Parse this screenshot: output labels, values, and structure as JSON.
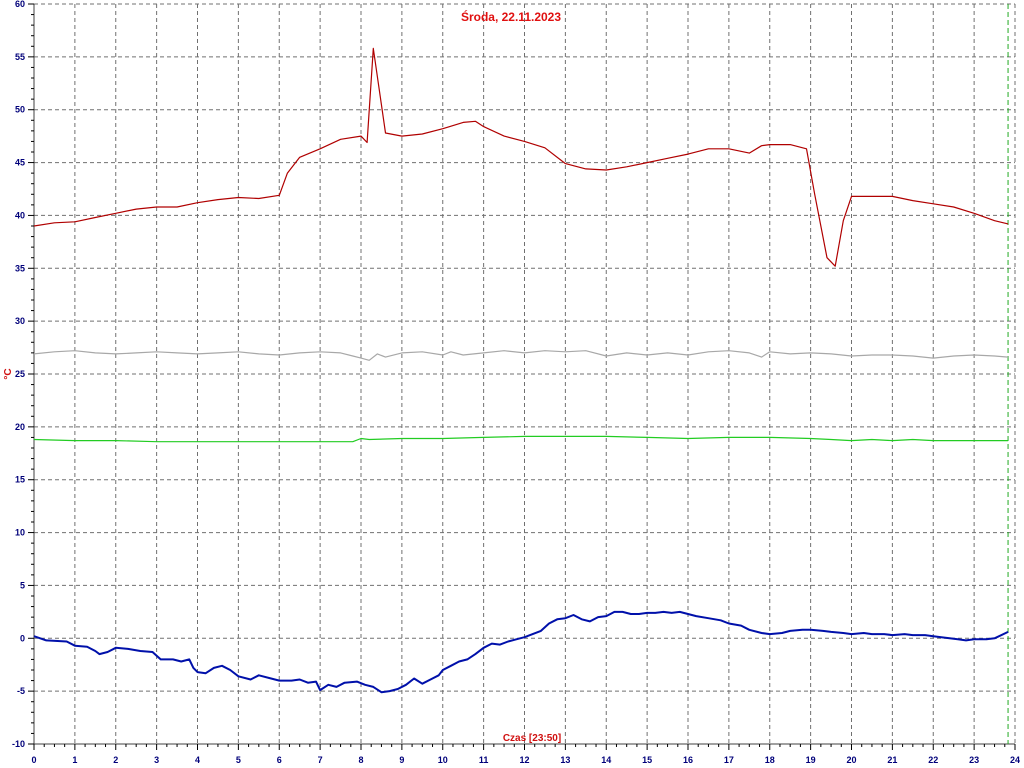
{
  "chart_data": {
    "type": "line",
    "title": "Środa, 22.11.2023",
    "xlabel": "Czas [23:50]",
    "ylabel": "°C",
    "xlim": [
      0,
      24
    ],
    "ylim": [
      -10,
      60
    ],
    "x_ticks": [
      0,
      1,
      2,
      3,
      4,
      5,
      6,
      7,
      8,
      9,
      10,
      11,
      12,
      13,
      14,
      15,
      16,
      17,
      18,
      19,
      20,
      21,
      22,
      23,
      24
    ],
    "y_ticks": [
      -10,
      -5,
      0,
      5,
      10,
      15,
      20,
      25,
      30,
      35,
      40,
      45,
      50,
      55,
      60
    ],
    "grid": true,
    "current_time_marker": 23.83,
    "series": [
      {
        "color": "#b00000",
        "points": [
          [
            0,
            39
          ],
          [
            0.5,
            39.3
          ],
          [
            1,
            39.4
          ],
          [
            1.5,
            39.8
          ],
          [
            2,
            40.2
          ],
          [
            2.5,
            40.6
          ],
          [
            3,
            40.8
          ],
          [
            3.5,
            40.8
          ],
          [
            4,
            41.2
          ],
          [
            4.5,
            41.5
          ],
          [
            5,
            41.7
          ],
          [
            5.5,
            41.6
          ],
          [
            6,
            41.9
          ],
          [
            6.2,
            44
          ],
          [
            6.5,
            45.5
          ],
          [
            7,
            46.3
          ],
          [
            7.5,
            47.2
          ],
          [
            8,
            47.5
          ],
          [
            8.15,
            46.9
          ],
          [
            8.3,
            55.8
          ],
          [
            8.6,
            47.8
          ],
          [
            9,
            47.5
          ],
          [
            9.5,
            47.7
          ],
          [
            10,
            48.2
          ],
          [
            10.5,
            48.8
          ],
          [
            10.8,
            48.9
          ],
          [
            11,
            48.4
          ],
          [
            11.5,
            47.5
          ],
          [
            12,
            47
          ],
          [
            12.5,
            46.4
          ],
          [
            13,
            44.9
          ],
          [
            13.5,
            44.4
          ],
          [
            14,
            44.3
          ],
          [
            14.5,
            44.6
          ],
          [
            15,
            45
          ],
          [
            15.5,
            45.4
          ],
          [
            16,
            45.8
          ],
          [
            16.5,
            46.3
          ],
          [
            17,
            46.3
          ],
          [
            17.5,
            45.9
          ],
          [
            17.8,
            46.6
          ],
          [
            18,
            46.7
          ],
          [
            18.5,
            46.7
          ],
          [
            18.9,
            46.3
          ],
          [
            19.1,
            42
          ],
          [
            19.4,
            36
          ],
          [
            19.6,
            35.2
          ],
          [
            19.8,
            39.5
          ],
          [
            20,
            41.8
          ],
          [
            20.5,
            41.8
          ],
          [
            21,
            41.8
          ],
          [
            21.5,
            41.4
          ],
          [
            22,
            41.1
          ],
          [
            22.5,
            40.8
          ],
          [
            23,
            40.2
          ],
          [
            23.5,
            39.5
          ],
          [
            23.83,
            39.2
          ]
        ]
      },
      {
        "color": "#a8a8a8",
        "points": [
          [
            0,
            26.9
          ],
          [
            0.5,
            27.1
          ],
          [
            1,
            27.2
          ],
          [
            1.5,
            27.0
          ],
          [
            2,
            26.9
          ],
          [
            2.5,
            27.0
          ],
          [
            3,
            27.1
          ],
          [
            3.5,
            27.0
          ],
          [
            4,
            26.9
          ],
          [
            4.5,
            27.0
          ],
          [
            5,
            27.1
          ],
          [
            5.5,
            26.9
          ],
          [
            6,
            26.8
          ],
          [
            6.5,
            27.0
          ],
          [
            7,
            27.1
          ],
          [
            7.5,
            27.0
          ],
          [
            7.8,
            26.7
          ],
          [
            8,
            26.5
          ],
          [
            8.2,
            26.3
          ],
          [
            8.4,
            26.9
          ],
          [
            8.6,
            26.6
          ],
          [
            9,
            27.0
          ],
          [
            9.5,
            27.1
          ],
          [
            10,
            26.8
          ],
          [
            10.2,
            27.1
          ],
          [
            10.5,
            26.8
          ],
          [
            11,
            27.0
          ],
          [
            11.5,
            27.2
          ],
          [
            12,
            27.0
          ],
          [
            12.5,
            27.2
          ],
          [
            13,
            27.1
          ],
          [
            13.5,
            27.2
          ],
          [
            14,
            26.7
          ],
          [
            14.5,
            27.0
          ],
          [
            15,
            26.8
          ],
          [
            15.5,
            27.0
          ],
          [
            16,
            26.8
          ],
          [
            16.5,
            27.1
          ],
          [
            17,
            27.2
          ],
          [
            17.5,
            27.0
          ],
          [
            17.8,
            26.6
          ],
          [
            18,
            27.1
          ],
          [
            18.5,
            26.9
          ],
          [
            19,
            27.0
          ],
          [
            19.5,
            26.9
          ],
          [
            20,
            26.7
          ],
          [
            20.5,
            26.8
          ],
          [
            21,
            26.8
          ],
          [
            21.5,
            26.7
          ],
          [
            22,
            26.5
          ],
          [
            22.5,
            26.7
          ],
          [
            23,
            26.8
          ],
          [
            23.5,
            26.7
          ],
          [
            23.83,
            26.6
          ]
        ]
      },
      {
        "color": "#22cc22",
        "points": [
          [
            0,
            18.8
          ],
          [
            1,
            18.7
          ],
          [
            2,
            18.7
          ],
          [
            3,
            18.6
          ],
          [
            4,
            18.6
          ],
          [
            5,
            18.6
          ],
          [
            6,
            18.6
          ],
          [
            7,
            18.6
          ],
          [
            7.8,
            18.6
          ],
          [
            8,
            18.9
          ],
          [
            8.2,
            18.8
          ],
          [
            9,
            18.9
          ],
          [
            10,
            18.9
          ],
          [
            11,
            19.0
          ],
          [
            12,
            19.1
          ],
          [
            13,
            19.1
          ],
          [
            14,
            19.1
          ],
          [
            15,
            19.0
          ],
          [
            16,
            18.9
          ],
          [
            17,
            19.0
          ],
          [
            18,
            19.0
          ],
          [
            19,
            18.9
          ],
          [
            19.5,
            18.8
          ],
          [
            20,
            18.7
          ],
          [
            20.5,
            18.8
          ],
          [
            21,
            18.7
          ],
          [
            21.5,
            18.8
          ],
          [
            22,
            18.7
          ],
          [
            23,
            18.7
          ],
          [
            23.83,
            18.7
          ]
        ]
      },
      {
        "color": "#0010aa",
        "points": [
          [
            0,
            0.2
          ],
          [
            0.3,
            -0.2
          ],
          [
            0.8,
            -0.3
          ],
          [
            1,
            -0.7
          ],
          [
            1.3,
            -0.8
          ],
          [
            1.5,
            -1.2
          ],
          [
            1.6,
            -1.5
          ],
          [
            1.8,
            -1.3
          ],
          [
            2,
            -0.9
          ],
          [
            2.3,
            -1.0
          ],
          [
            2.6,
            -1.2
          ],
          [
            2.9,
            -1.3
          ],
          [
            3.1,
            -2.0
          ],
          [
            3.4,
            -2.0
          ],
          [
            3.6,
            -2.2
          ],
          [
            3.8,
            -2.0
          ],
          [
            3.9,
            -2.8
          ],
          [
            4.0,
            -3.2
          ],
          [
            4.2,
            -3.3
          ],
          [
            4.4,
            -2.8
          ],
          [
            4.6,
            -2.6
          ],
          [
            4.8,
            -3.0
          ],
          [
            5.0,
            -3.6
          ],
          [
            5.3,
            -3.9
          ],
          [
            5.5,
            -3.5
          ],
          [
            5.8,
            -3.8
          ],
          [
            6.0,
            -4.0
          ],
          [
            6.3,
            -4.0
          ],
          [
            6.5,
            -3.9
          ],
          [
            6.7,
            -4.2
          ],
          [
            6.9,
            -4.1
          ],
          [
            7.0,
            -4.9
          ],
          [
            7.2,
            -4.4
          ],
          [
            7.4,
            -4.6
          ],
          [
            7.6,
            -4.2
          ],
          [
            7.9,
            -4.1
          ],
          [
            8.1,
            -4.4
          ],
          [
            8.3,
            -4.6
          ],
          [
            8.5,
            -5.1
          ],
          [
            8.7,
            -5.0
          ],
          [
            8.9,
            -4.8
          ],
          [
            9.1,
            -4.4
          ],
          [
            9.3,
            -3.8
          ],
          [
            9.5,
            -4.3
          ],
          [
            9.7,
            -3.9
          ],
          [
            9.9,
            -3.5
          ],
          [
            10.0,
            -3.0
          ],
          [
            10.2,
            -2.6
          ],
          [
            10.4,
            -2.2
          ],
          [
            10.6,
            -2.0
          ],
          [
            10.8,
            -1.5
          ],
          [
            11.0,
            -0.9
          ],
          [
            11.2,
            -0.5
          ],
          [
            11.4,
            -0.6
          ],
          [
            11.6,
            -0.3
          ],
          [
            11.8,
            -0.1
          ],
          [
            12.0,
            0.1
          ],
          [
            12.2,
            0.4
          ],
          [
            12.4,
            0.7
          ],
          [
            12.6,
            1.4
          ],
          [
            12.8,
            1.8
          ],
          [
            13.0,
            1.9
          ],
          [
            13.2,
            2.2
          ],
          [
            13.4,
            1.8
          ],
          [
            13.6,
            1.6
          ],
          [
            13.8,
            2.0
          ],
          [
            14.0,
            2.1
          ],
          [
            14.2,
            2.5
          ],
          [
            14.4,
            2.5
          ],
          [
            14.6,
            2.3
          ],
          [
            14.8,
            2.3
          ],
          [
            15.0,
            2.4
          ],
          [
            15.2,
            2.4
          ],
          [
            15.4,
            2.5
          ],
          [
            15.6,
            2.4
          ],
          [
            15.8,
            2.5
          ],
          [
            16.0,
            2.3
          ],
          [
            16.2,
            2.1
          ],
          [
            16.5,
            1.9
          ],
          [
            16.8,
            1.7
          ],
          [
            17.0,
            1.4
          ],
          [
            17.3,
            1.2
          ],
          [
            17.5,
            0.8
          ],
          [
            17.8,
            0.5
          ],
          [
            18.0,
            0.4
          ],
          [
            18.3,
            0.5
          ],
          [
            18.5,
            0.7
          ],
          [
            18.8,
            0.8
          ],
          [
            19.0,
            0.8
          ],
          [
            19.3,
            0.7
          ],
          [
            19.5,
            0.6
          ],
          [
            19.8,
            0.5
          ],
          [
            20.0,
            0.4
          ],
          [
            20.3,
            0.5
          ],
          [
            20.5,
            0.4
          ],
          [
            20.8,
            0.4
          ],
          [
            21.0,
            0.3
          ],
          [
            21.3,
            0.4
          ],
          [
            21.5,
            0.3
          ],
          [
            21.8,
            0.3
          ],
          [
            22.0,
            0.2
          ],
          [
            22.2,
            0.1
          ],
          [
            22.4,
            0.0
          ],
          [
            22.6,
            -0.1
          ],
          [
            22.8,
            -0.2
          ],
          [
            23.0,
            -0.1
          ],
          [
            23.3,
            -0.1
          ],
          [
            23.5,
            0.0
          ],
          [
            23.83,
            0.6
          ]
        ]
      }
    ]
  }
}
